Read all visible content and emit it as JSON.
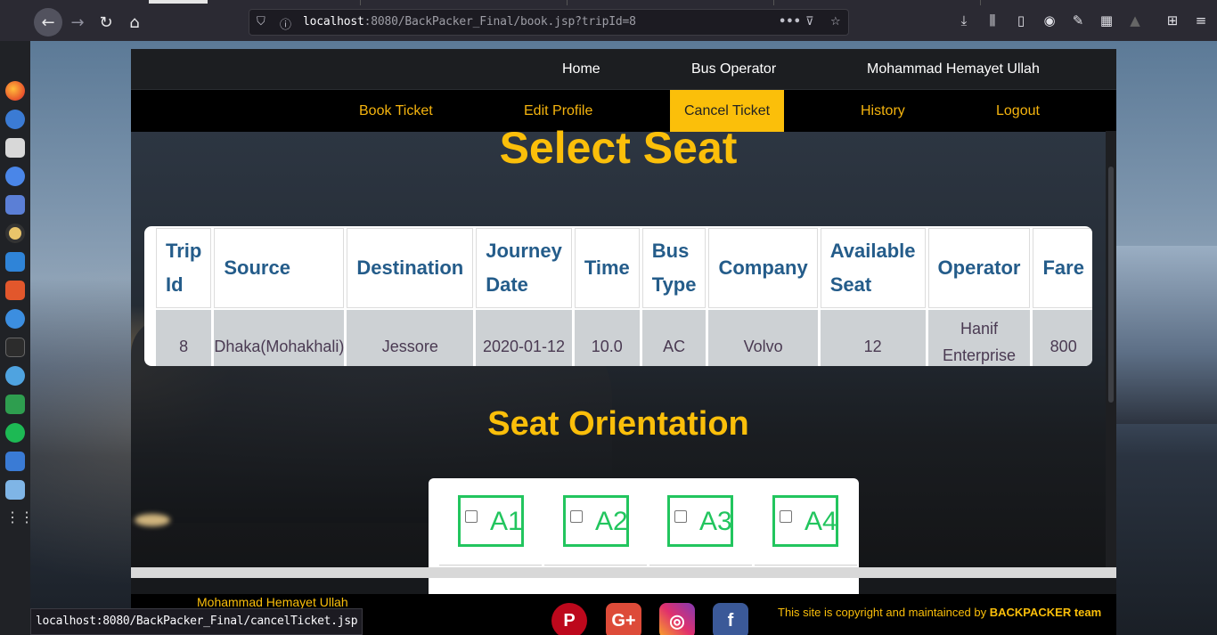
{
  "browser": {
    "url_host": "localhost",
    "url_rest": ":8080/BackPacker_Final/book.jsp?tripId=8"
  },
  "nav_top": {
    "home": "Home",
    "bus_operator": "Bus Operator",
    "user": "Mohammad Hemayet Ullah"
  },
  "nav_main": {
    "book_ticket": "Book Ticket",
    "edit_profile": "Edit Profile",
    "cancel_ticket": "Cancel Ticket",
    "history": "History",
    "logout": "Logout"
  },
  "headings": {
    "select_seat": "Select Seat",
    "seat_orientation": "Seat Orientation"
  },
  "trip_table": {
    "headers": [
      {
        "l1": "Trip",
        "l2": "Id"
      },
      {
        "l1": "Source",
        "l2": ""
      },
      {
        "l1": "Destination",
        "l2": ""
      },
      {
        "l1": "Journey",
        "l2": "Date"
      },
      {
        "l1": "Time",
        "l2": ""
      },
      {
        "l1": "Bus",
        "l2": "Type"
      },
      {
        "l1": "Company",
        "l2": ""
      },
      {
        "l1": "Available",
        "l2": "Seat"
      },
      {
        "l1": "Operator",
        "l2": ""
      },
      {
        "l1": "Fare",
        "l2": ""
      }
    ],
    "row": {
      "trip_id": "8",
      "source": "Dhaka(Mohakhali)",
      "destination": "Jessore",
      "journey_date": "2020-01-12",
      "time": "10.0",
      "bus_type": "AC",
      "company": "Volvo",
      "available_seat": "12",
      "operator_l1": "Hanif",
      "operator_l2": "Enterprise",
      "fare": "800"
    }
  },
  "seats": [
    "A1",
    "A2",
    "A3",
    "A4"
  ],
  "footer": {
    "user_name": "Mohammad Hemayet Ullah",
    "copyright_text": "This site is copyright and maintainced by ",
    "team": "BACKPACKER team",
    "social": {
      "pinterest": "P",
      "google_plus": "G+",
      "instagram": "◎",
      "facebook": "f"
    }
  },
  "status_bar": "localhost:8080/BackPacker_Final/cancelTicket.jsp",
  "colors": {
    "accent": "#fbbf0a",
    "heading_blue": "#245c8a",
    "seat_green": "#22c55e"
  }
}
